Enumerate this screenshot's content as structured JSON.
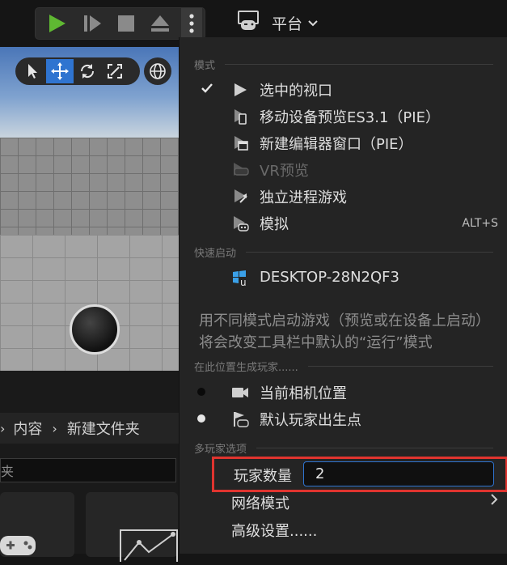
{
  "toolbar": {
    "platform_label": "平台",
    "play_icon": "play-icon",
    "step_icon": "step-icon",
    "stop_icon": "stop-icon",
    "eject_icon": "eject-icon",
    "more_icon": "more-vertical-icon",
    "play_color": "#5fb832"
  },
  "content_browser": {
    "breadcrumb": [
      "内容",
      "新建文件夹"
    ],
    "filter_text": "夹"
  },
  "menu": {
    "sections": {
      "mode": "模式",
      "quick_launch": "快速启动",
      "spawn_location": "在此位置生成玩家......",
      "multiplayer": "多玩家选项"
    },
    "mode_items": [
      {
        "label": "选中的视口",
        "checked": true
      },
      {
        "label": "移动设备预览ES3.1（PIE）"
      },
      {
        "label": "新建编辑器窗口（PIE）"
      },
      {
        "label": "VR预览",
        "disabled": true
      },
      {
        "label": "独立进程游戏"
      },
      {
        "label": "模拟",
        "shortcut": "ALT+S"
      }
    ],
    "quick_launch_items": [
      {
        "label": "DESKTOP-28N2QF3"
      }
    ],
    "description": "用不同模式启动游戏（预览或在设备上启动）将会改变工具栏中默认的“运行”模式",
    "spawn_items": [
      {
        "label": "当前相机位置",
        "selected": true
      },
      {
        "label": "默认玩家出生点",
        "selected": false
      }
    ],
    "multiplayer": {
      "num_players_label": "玩家数量",
      "num_players_value": "2",
      "net_mode_label": "网络模式",
      "advanced_label": "高级设置......"
    },
    "highlight_color": "#e0342f",
    "accent_color": "#2f74d0"
  }
}
